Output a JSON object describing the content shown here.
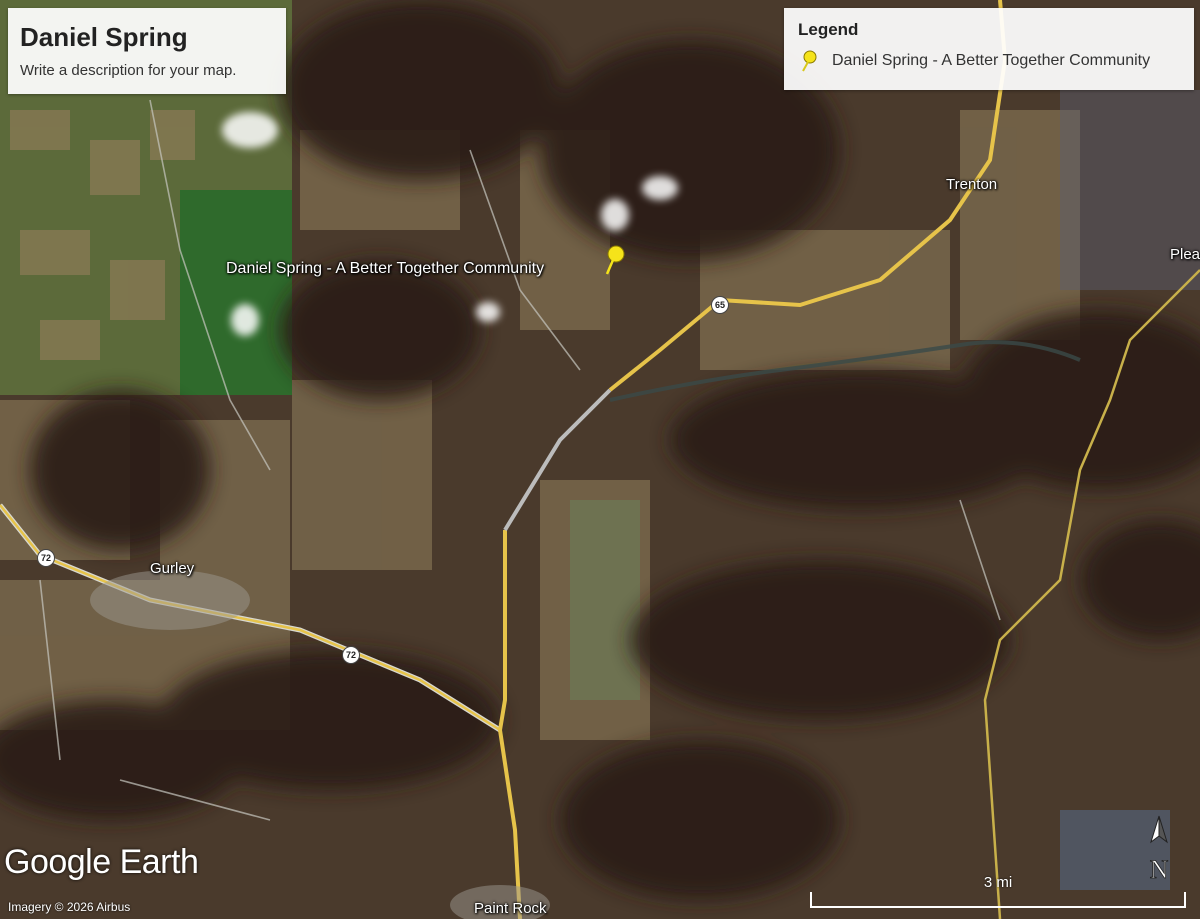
{
  "map": {
    "title": "Daniel Spring",
    "description": "Write a description for your map.",
    "legend_title": "Legend",
    "legend_items": [
      {
        "label": "Daniel Spring - A Better Together Community",
        "icon": "yellow-pushpin-icon"
      }
    ],
    "placemark_label": "Daniel Spring - A Better Together Community",
    "place_labels": [
      "Trenton",
      "Plea",
      "Gurley",
      "Paint Rock"
    ],
    "route_shields": [
      "65",
      "72",
      "72"
    ],
    "logo": "Google Earth",
    "copyright": "Imagery © 2026 Airbus",
    "scale_label": "3 mi",
    "north_label": "N",
    "colors": {
      "road_yellow": "#e6c34a",
      "pin_yellow": "#f5e31a",
      "panel_bg": "#ffffff"
    }
  }
}
